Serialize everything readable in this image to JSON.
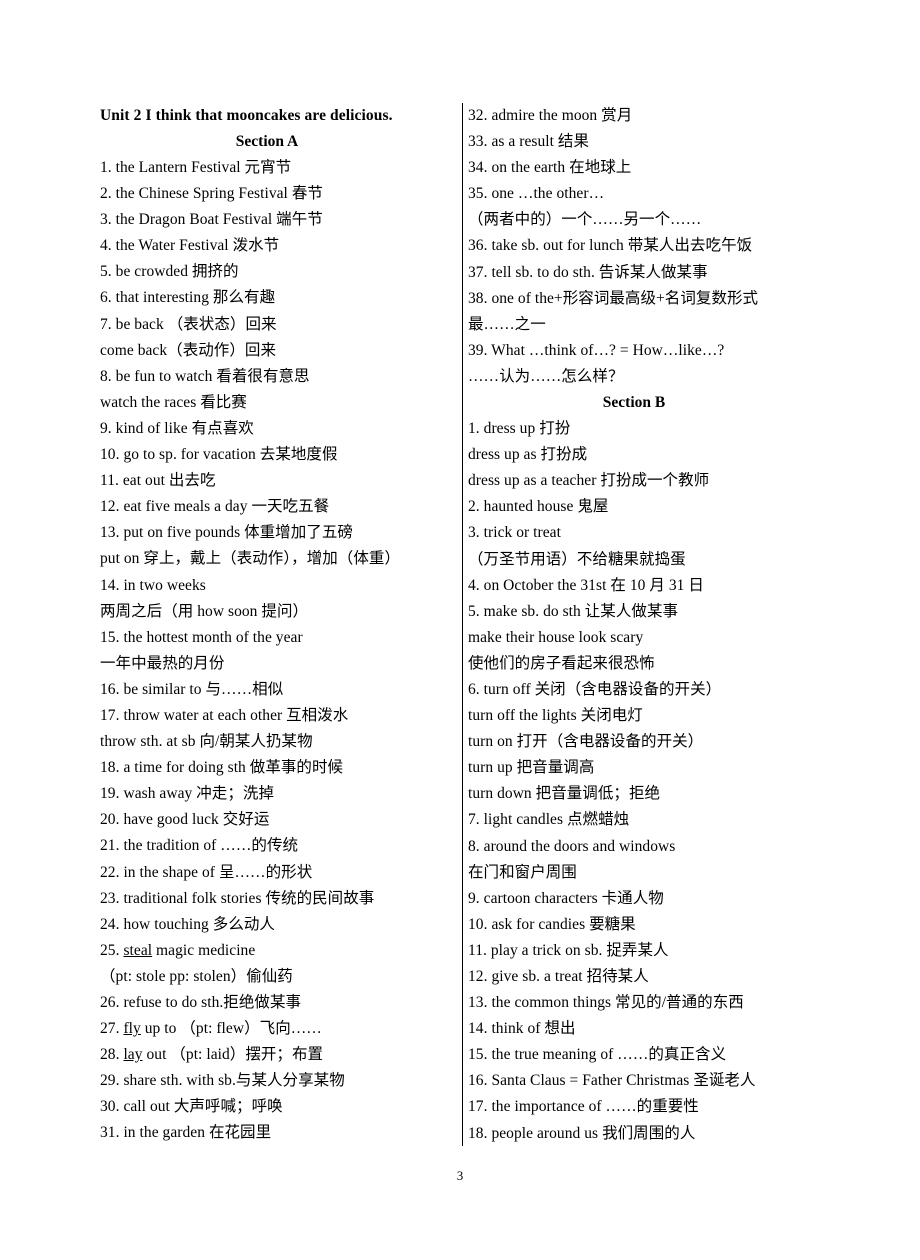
{
  "document": {
    "page_number": "3",
    "unit_title": "Unit 2    I think that mooncakes are delicious.",
    "section_a_heading": "Section A",
    "section_b_heading": "Section B"
  },
  "left_column": {
    "entries": [
      "1. the Lantern Festival 元宵节",
      "2. the Chinese Spring Festival 春节",
      "3. the Dragon Boat Festival 端午节",
      "4. the Water Festival 泼水节",
      "5. be crowded 拥挤的",
      "6. that interesting 那么有趣",
      "7. be back （表状态）回来",
      "come back（表动作）回来",
      "8. be fun to watch 看着很有意思",
      "watch the races 看比赛",
      "9. kind of like 有点喜欢",
      "10. go to sp. for vacation 去某地度假",
      "11. eat out 出去吃",
      "12. eat five meals a day 一天吃五餐",
      "13. put on five pounds 体重增加了五磅",
      "put on 穿上，戴上（表动作），增加（体重）",
      "14. in two weeks",
      "两周之后（用 how soon 提问）",
      "15. the hottest month of the year",
      "一年中最热的月份",
      "16. be similar to 与……相似",
      "17. throw water at each other 互相泼水",
      "throw sth. at sb 向/朝某人扔某物",
      "18. a time for doing sth 做革事的时候",
      "19. wash away 冲走；洗掉",
      "20. have good luck 交好运",
      "21. the tradition of ……的传统",
      "22. in the shape of 呈……的形状",
      "23. traditional folk stories 传统的民间故事",
      "24. how touching 多么动人",
      "25. steal magic medicine",
      "（pt: stole    pp: stolen）偷仙药",
      "26. refuse to do sth.拒绝做某事",
      "27. fly up to （pt: flew）飞向……",
      "28. lay out （pt: laid）摆开；布置",
      "29. share sth. with sb.与某人分享某物",
      "30. call out 大声呼喊；呼唤",
      "31. in the garden 在花园里"
    ],
    "underlined": {
      "30": "steal",
      "33": "fly",
      "34": "lay"
    }
  },
  "right_column": {
    "entries_before_section_b": [
      "32. admire the moon 赏月",
      "33. as a result 结果",
      "34. on the earth 在地球上",
      "35. one …the other…",
      "（两者中的）一个……另一个……",
      "36. take sb. out for lunch 带某人出去吃午饭",
      "37. tell sb. to do sth. 告诉某人做某事",
      "38. one of the+形容词最高级+名词复数形式",
      "最……之一",
      "39. What …think of…?   = How…like…?",
      "……认为……怎么样？"
    ],
    "entries_after_section_b": [
      "1. dress up 打扮",
      "dress up as 打扮成",
      "dress up as a teacher 打扮成一个教师",
      "2. haunted house 鬼屋",
      "3. trick or treat",
      "（万圣节用语）不给糖果就捣蛋",
      "4. on October the 31st 在 10 月 31 日",
      "5. make sb. do sth 让某人做某事",
      "make their house look scary",
      "使他们的房子看起来很恐怖",
      "6. turn off 关闭（含电器设备的开关）",
      "turn off the lights 关闭电灯",
      "turn on 打开（含电器设备的开关）",
      "turn up 把音量调高",
      "turn down 把音量调低；拒绝",
      "7. light candles 点燃蜡烛",
      "8. around the doors and windows",
      "在门和窗户周围",
      "9. cartoon characters 卡通人物",
      "10. ask for candies 要糖果",
      "11. play a trick on sb. 捉弄某人",
      "12. give sb. a treat 招待某人",
      "13. the common things 常见的/普通的东西",
      "14. think of 想出",
      "15. the true meaning of ……的真正含义",
      "16. Santa Claus = Father Christmas 圣诞老人",
      "17. the importance of ……的重要性",
      "18. people around us 我们周围的人"
    ]
  }
}
